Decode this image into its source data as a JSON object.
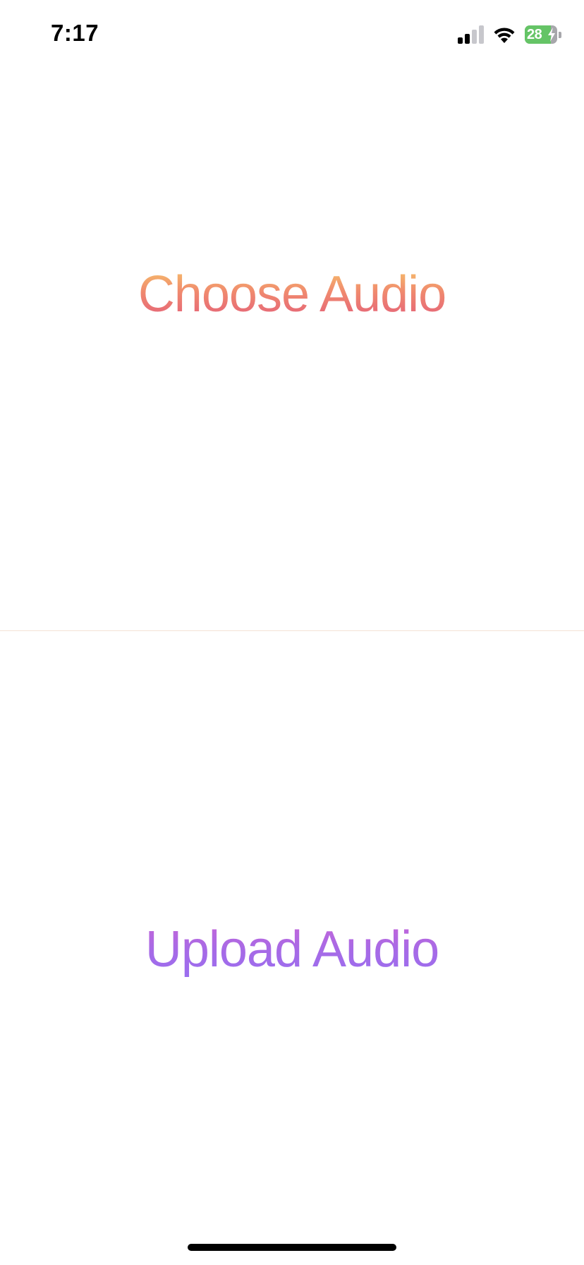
{
  "status_bar": {
    "time": "7:17",
    "battery_level": "28",
    "battery_fraction": 0.28,
    "battery_charging": true,
    "signal_bars_active": 2,
    "signal_bars_total": 4,
    "icons": [
      "cellular-signal-icon",
      "wifi-icon",
      "battery-charging-icon"
    ]
  },
  "main": {
    "choose_label": "Choose Audio",
    "upload_label": "Upload Audio"
  },
  "colors": {
    "choose_gradient": [
      "#f7c66a",
      "#f08a6e",
      "#e35d7b"
    ],
    "upload_gradient": [
      "#c665d8",
      "#a76ae6",
      "#9a6ef0"
    ],
    "divider": "#f3e2d6",
    "battery_fill": "#65c466"
  }
}
